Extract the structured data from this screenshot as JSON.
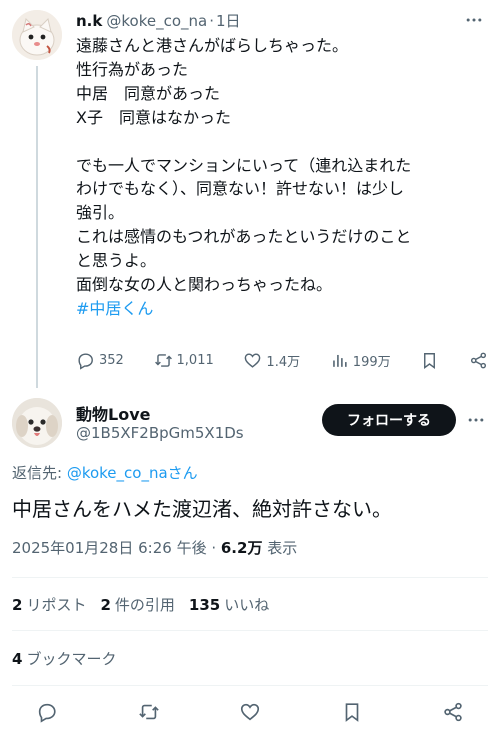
{
  "tweet1": {
    "author_name": "n.k",
    "handle": "@koke_co_na",
    "separator": "·",
    "time": "1日",
    "body_lines": [
      "遠藤さんと港さんがばらしちゃった。",
      "性行為があった",
      "中居　同意があった",
      "X子　同意はなかった",
      "",
      "でも一人でマンションにいって（連れ込まれた",
      "わけでもなく）、同意ない！許せない！は少し",
      "強引。",
      "これは感情のもつれがあったというだけのこと",
      "と思うよ。",
      "面倒な女の人と関わっちゃったね。"
    ],
    "hashtag": "#中居くん",
    "actions": {
      "replies": "352",
      "retweets": "1,011",
      "likes": "1.4万",
      "views": "199万"
    }
  },
  "tweet2": {
    "author_name": "動物Love",
    "handle": "@1B5XF2BpGm5X1Ds",
    "follow_label": "フォローする",
    "reply_prefix": "返信先: ",
    "reply_mention": "@koke_co_naさん",
    "text": "中居さんをハメた渡辺渚、絶対許さない。",
    "timestamp": "2025年01月28日 6:26 午後 · ",
    "views_count": "6.2万",
    "views_label": " 表示",
    "stats": {
      "reposts_count": "2",
      "reposts_label": "リポスト",
      "quotes_count": "2",
      "quotes_label": "件の引用",
      "likes_count": "135",
      "likes_label": "いいね"
    },
    "bookmarks_count": "4",
    "bookmarks_label": "ブックマーク"
  },
  "icons": {
    "more": "more-icon",
    "reply": "reply-icon",
    "retweet": "retweet-icon",
    "like": "heart-icon",
    "views": "views-icon",
    "bookmark": "bookmark-icon",
    "share": "share-icon"
  },
  "colors": {
    "text": "#0f1419",
    "secondary": "#536471",
    "link": "#1d9bf0",
    "button_bg": "#0f1419",
    "divider": "#eff3f4",
    "thread_line": "#cfd9de"
  }
}
